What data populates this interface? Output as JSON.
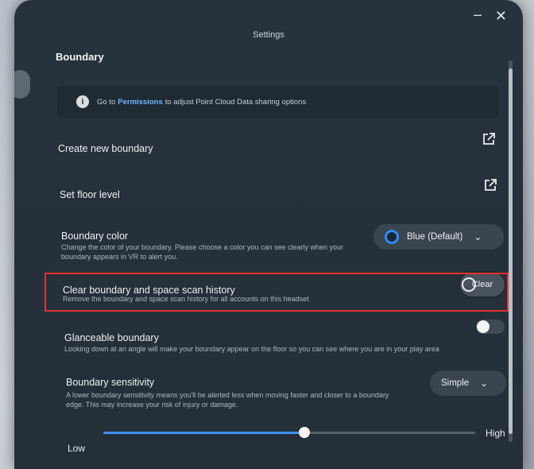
{
  "window": {
    "title": "Settings",
    "minimize_icon": "–",
    "close_icon": "✕"
  },
  "section": {
    "title": "Boundary"
  },
  "info_banner": {
    "icon": "i",
    "prefix": "Go to",
    "link": "Permissions",
    "suffix": "to adjust Point Cloud Data sharing options"
  },
  "rows": {
    "create_boundary": {
      "title": "Create new boundary"
    },
    "floor_level": {
      "title": "Set floor level"
    },
    "boundary_color": {
      "title": "Boundary color",
      "desc_line1": "Change the color of your boundary. Please choose a color you can see clearly when your",
      "desc_line2": "boundary appears in VR to alert you.",
      "selected": "Blue (Default)"
    },
    "clear_history": {
      "title": "Clear boundary and space scan history",
      "desc": "Remove the boundary and space scan history for all accounts on this headset",
      "button": "Clear"
    },
    "glanceable": {
      "title": "Glanceable boundary",
      "desc": "Looking down at an angle will make your boundary appear on the floor so you can see where you are in your play area",
      "enabled": false
    },
    "sensitivity": {
      "title": "Boundary sensitivity",
      "desc_line1": "A lower boundary sensitivity means you'll be alerted less when moving faster and closer to a boundary",
      "desc_line2": "edge. This may increase your risk of injury or damage.",
      "selected": "Simple",
      "slider_low": "Low",
      "slider_high": "High",
      "slider_value": 0.54
    }
  },
  "colors": {
    "panel": "#26313b",
    "accent": "#3f8fff",
    "highlight": "#e5302e"
  }
}
